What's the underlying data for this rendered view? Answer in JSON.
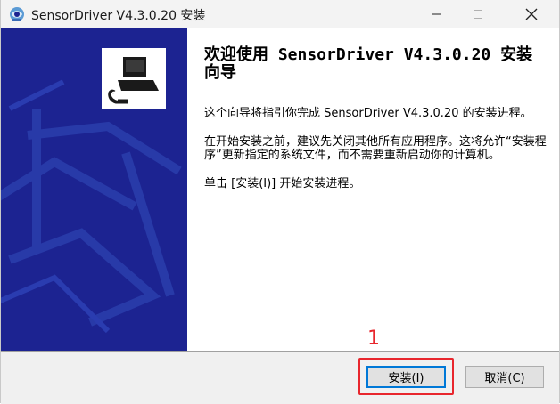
{
  "window": {
    "title": "SensorDriver V4.3.0.20 安装"
  },
  "title_controls": {
    "minimize": "—",
    "maximize": "☐",
    "close": "✕"
  },
  "content": {
    "heading": "欢迎使用 SensorDriver V4.3.0.20 安装向导",
    "para1": "这个向导将指引你完成 SensorDriver V4.3.0.20 的安装进程。",
    "para2": "在开始安装之前，建议先关闭其他所有应用程序。这将允许“安装程序”更新指定的系统文件，而不需要重新启动你的计算机。",
    "para3": "单击 [安装(I)] 开始安装进程。"
  },
  "buttons": {
    "install": "安装(I)",
    "cancel": "取消(C)"
  },
  "annotation": {
    "step_number": "1",
    "color": "#e8262d"
  },
  "colors": {
    "banner": "#1c2391",
    "focus": "#0078d7"
  },
  "icons": {
    "app": "installer-app-icon",
    "banner": "installer-computer-icon"
  }
}
